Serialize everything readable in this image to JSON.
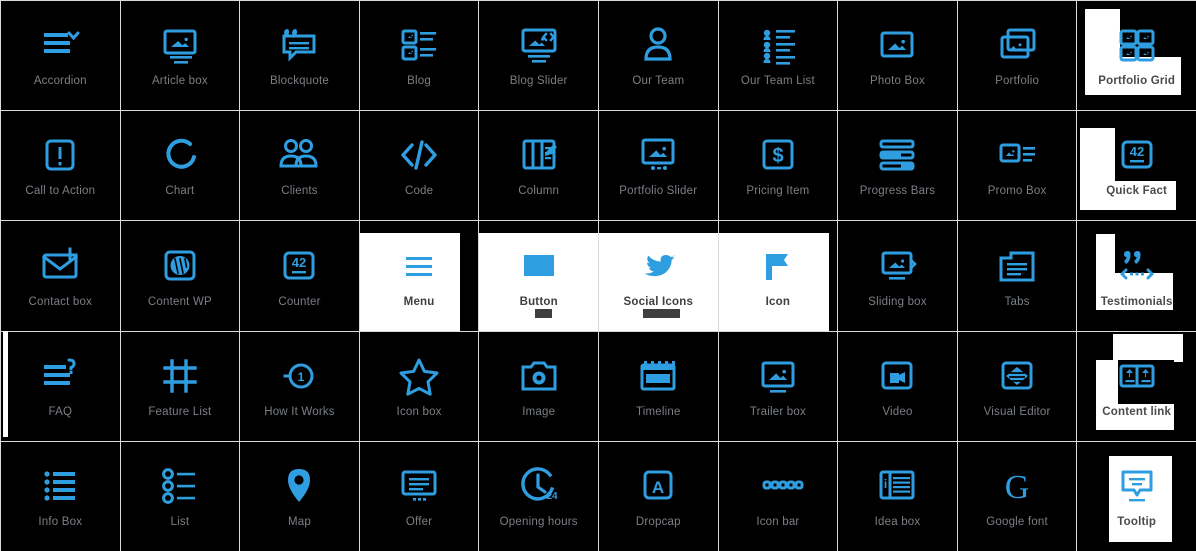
{
  "theme": {
    "background": "#000000",
    "grid_line": "#d9d9d9",
    "icon_accent": "#2f9ee0",
    "label_color": "#7b7f85",
    "highlight_overlay": "#ffffff",
    "highlight_label_color": "#404040"
  },
  "grid": {
    "columns": 10,
    "rows": 5,
    "cells": [
      {
        "label": "Accordion",
        "icon": "accordion-icon",
        "state": "normal"
      },
      {
        "label": "Article box",
        "icon": "article-box-icon",
        "state": "normal"
      },
      {
        "label": "Blockquote",
        "icon": "blockquote-icon",
        "state": "normal"
      },
      {
        "label": "Blog",
        "icon": "blog-icon",
        "state": "normal"
      },
      {
        "label": "Blog Slider",
        "icon": "blog-slider-icon",
        "state": "normal"
      },
      {
        "label": "Our Team",
        "icon": "our-team-icon",
        "state": "normal"
      },
      {
        "label": "Our Team List",
        "icon": "our-team-list-icon",
        "state": "normal"
      },
      {
        "label": "Photo Box",
        "icon": "photo-box-icon",
        "state": "normal"
      },
      {
        "label": "Portfolio",
        "icon": "portfolio-icon",
        "state": "normal"
      },
      {
        "label": "Portfolio Grid",
        "icon": "portfolio-grid-icon",
        "state": "overlay-white"
      },
      {
        "label": "Call to Action",
        "icon": "call-to-action-icon",
        "state": "normal"
      },
      {
        "label": "Chart",
        "icon": "chart-icon",
        "state": "normal"
      },
      {
        "label": "Clients",
        "icon": "clients-icon",
        "state": "normal"
      },
      {
        "label": "Code",
        "icon": "code-icon",
        "state": "normal"
      },
      {
        "label": "Column",
        "icon": "column-icon",
        "state": "normal"
      },
      {
        "label": "Portfolio Slider",
        "icon": "portfolio-slider-icon",
        "state": "normal"
      },
      {
        "label": "Pricing Item",
        "icon": "pricing-item-icon",
        "state": "normal"
      },
      {
        "label": "Progress Bars",
        "icon": "progress-bars-icon",
        "state": "normal"
      },
      {
        "label": "Promo Box",
        "icon": "promo-box-icon",
        "state": "normal"
      },
      {
        "label": "Quick Fact",
        "icon": "quick-fact-icon",
        "state": "overlay-white"
      },
      {
        "label": "Contact box",
        "icon": "contact-box-icon",
        "state": "normal"
      },
      {
        "label": "Content WP",
        "icon": "content-wp-icon",
        "state": "normal"
      },
      {
        "label": "Counter",
        "icon": "counter-icon",
        "state": "normal"
      },
      {
        "label": "Menu",
        "icon": "menu-icon",
        "state": "white-surface"
      },
      {
        "label": "Button",
        "icon": "button-icon",
        "state": "white-surface"
      },
      {
        "label": "Social Icons",
        "icon": "social-icons-icon",
        "state": "white-surface"
      },
      {
        "label": "Icon",
        "icon": "icon-flag-icon",
        "state": "white-surface"
      },
      {
        "label": "Sliding box",
        "icon": "sliding-box-icon",
        "state": "normal"
      },
      {
        "label": "Tabs",
        "icon": "tabs-icon",
        "state": "normal"
      },
      {
        "label": "Testimonials",
        "icon": "testimonials-icon",
        "state": "overlay-white"
      },
      {
        "label": "FAQ",
        "icon": "faq-icon",
        "state": "normal"
      },
      {
        "label": "Feature List",
        "icon": "feature-list-icon",
        "state": "normal"
      },
      {
        "label": "How It Works",
        "icon": "how-it-works-icon",
        "state": "normal"
      },
      {
        "label": "Icon box",
        "icon": "icon-box-icon",
        "state": "normal"
      },
      {
        "label": "Image",
        "icon": "image-icon",
        "state": "normal"
      },
      {
        "label": "Timeline",
        "icon": "timeline-icon",
        "state": "normal"
      },
      {
        "label": "Trailer box",
        "icon": "trailer-box-icon",
        "state": "normal"
      },
      {
        "label": "Video",
        "icon": "video-icon",
        "state": "normal"
      },
      {
        "label": "Visual Editor",
        "icon": "visual-editor-icon",
        "state": "normal"
      },
      {
        "label": "Content link",
        "icon": "content-link-icon",
        "state": "overlay-white"
      },
      {
        "label": "Info Box",
        "icon": "info-box-icon",
        "state": "normal"
      },
      {
        "label": "List",
        "icon": "list-icon",
        "state": "normal"
      },
      {
        "label": "Map",
        "icon": "map-icon",
        "state": "normal"
      },
      {
        "label": "Offer",
        "icon": "offer-icon",
        "state": "normal"
      },
      {
        "label": "Opening hours",
        "icon": "opening-hours-icon",
        "state": "normal"
      },
      {
        "label": "Dropcap",
        "icon": "dropcap-icon",
        "state": "normal"
      },
      {
        "label": "Icon bar",
        "icon": "icon-bar-icon",
        "state": "normal"
      },
      {
        "label": "Idea box",
        "icon": "idea-box-icon",
        "state": "normal"
      },
      {
        "label": "Google font",
        "icon": "google-font-icon",
        "state": "normal"
      },
      {
        "label": "Tooltip",
        "icon": "tooltip-icon",
        "state": "overlay-white"
      }
    ]
  },
  "icon_badges": {
    "quick_fact_number": "42",
    "counter_number": "42",
    "opening_hours_number": "24",
    "dropcap_letter": "A",
    "google_font_letter": "G",
    "idea_box_letter": "i"
  }
}
